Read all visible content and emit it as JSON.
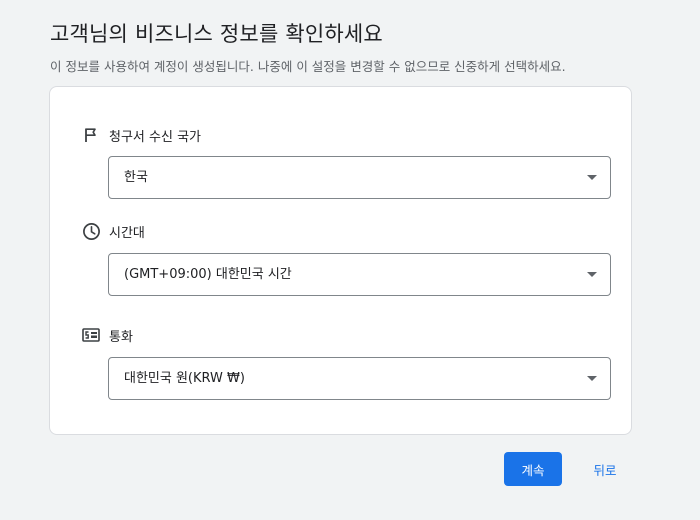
{
  "header": {
    "title": "고객님의 비즈니스 정보를 확인하세요",
    "subtitle": "이 정보를 사용하여 계정이 생성됩니다. 나중에 이 설정을 변경할 수 없으므로 신중하게 선택하세요."
  },
  "form": {
    "billing_country": {
      "icon": "flag-icon",
      "label": "청구서 수신 국가",
      "value": "한국"
    },
    "time_zone": {
      "icon": "clock-icon",
      "label": "시간대",
      "value": "(GMT+09:00) 대한민국 시간"
    },
    "currency": {
      "icon": "currency-icon",
      "label": "통화",
      "value": "대한민국 원(KRW ₩)"
    }
  },
  "actions": {
    "continue_label": "계속",
    "back_label": "뒤로"
  },
  "colors": {
    "primary": "#1a73e8",
    "background": "#f1f3f4",
    "card": "#ffffff",
    "icon": "#3c4043"
  }
}
